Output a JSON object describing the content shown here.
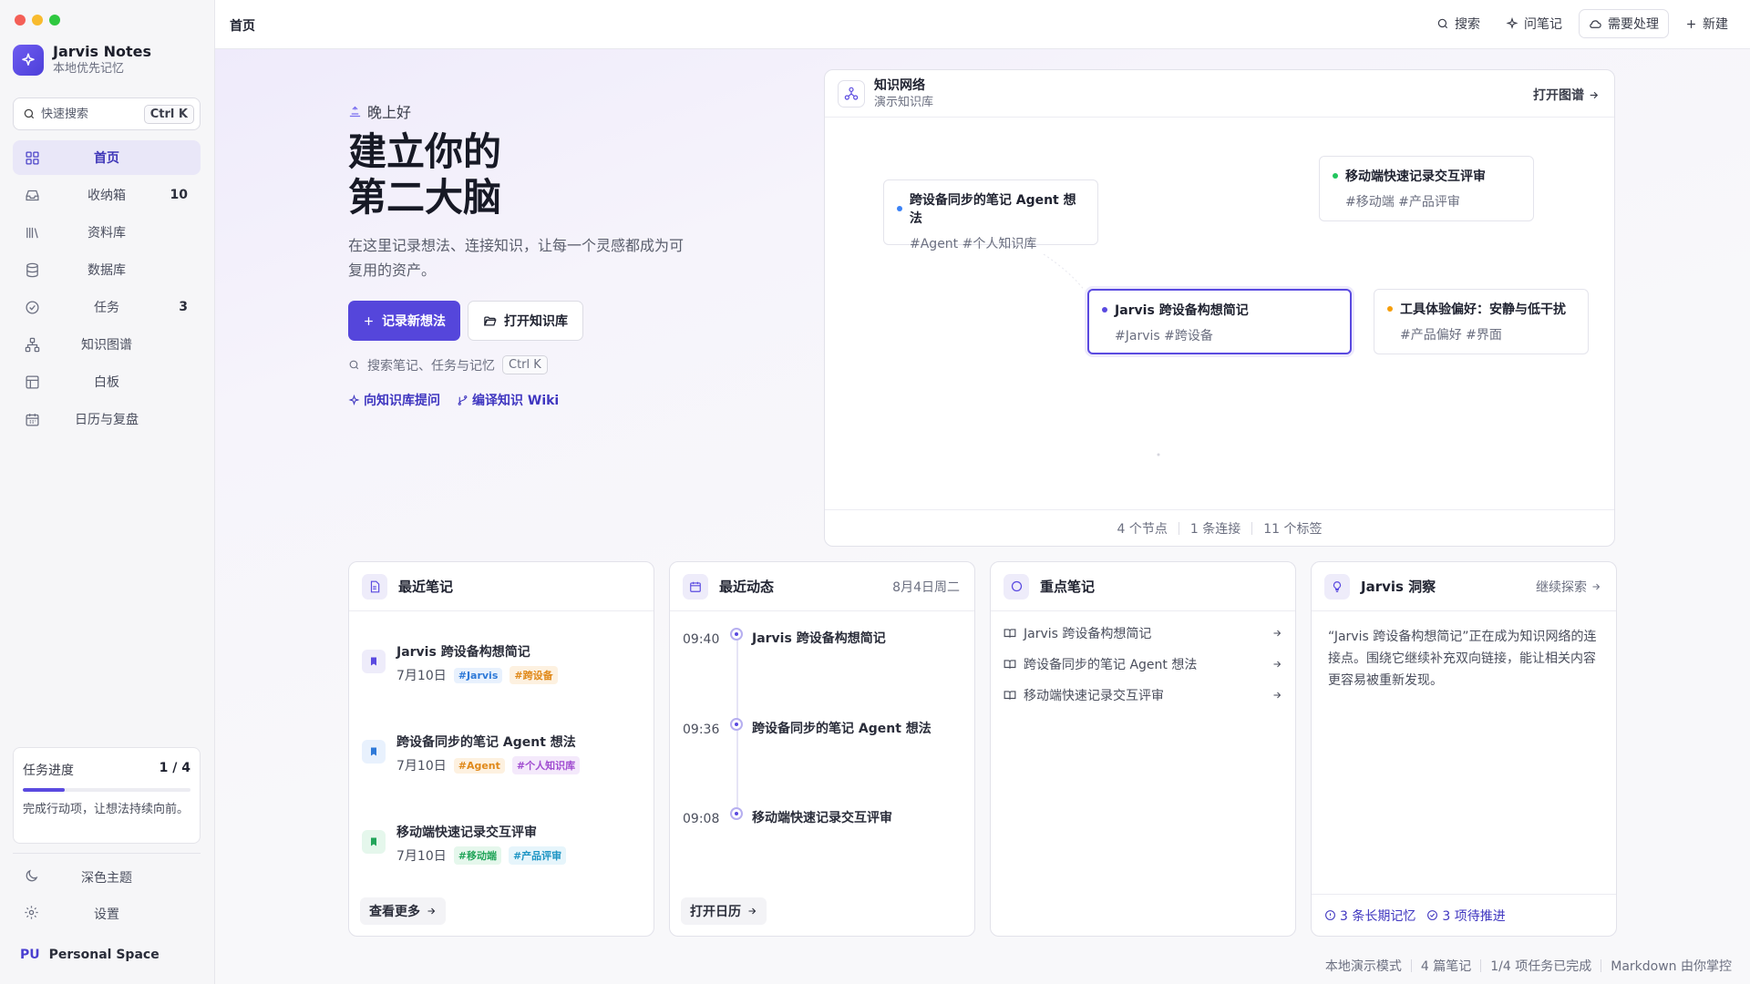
{
  "app": {
    "name": "Jarvis Notes",
    "subtitle": "本地优先记忆"
  },
  "sidebar": {
    "search_placeholder": "快速搜索",
    "search_shortcut": "Ctrl K",
    "items": [
      {
        "label": "首页",
        "icon": "grid-icon",
        "count": ""
      },
      {
        "label": "收纳箱",
        "icon": "inbox-icon",
        "count": "10"
      },
      {
        "label": "资料库",
        "icon": "library-icon",
        "count": ""
      },
      {
        "label": "数据库",
        "icon": "database-icon",
        "count": ""
      },
      {
        "label": "任务",
        "icon": "check-circle-icon",
        "count": "3"
      },
      {
        "label": "知识图谱",
        "icon": "graph-icon",
        "count": ""
      },
      {
        "label": "白板",
        "icon": "whiteboard-icon",
        "count": ""
      },
      {
        "label": "日历与复盘",
        "icon": "calendar-icon",
        "count": ""
      }
    ],
    "progress": {
      "label": "任务进度",
      "value": "1 / 4",
      "fraction": 0.25,
      "note": "完成行动项，让想法持续向前。"
    },
    "dark_theme": "深色主题",
    "settings": "设置",
    "space": {
      "badge": "PU",
      "name": "Personal Space"
    }
  },
  "topbar": {
    "breadcrumb": "首页",
    "search": "搜索",
    "ask": "问笔记",
    "needs_action": "需要处理",
    "new": "新建"
  },
  "hero": {
    "greeting": "晚上好",
    "title_line1": "建立你的",
    "title_line2": "第二大脑",
    "description": "在这里记录想法、连接知识，让每一个灵感都成为可复用的资产。",
    "primary_button": "记录新想法",
    "secondary_button": "打开知识库",
    "search_hint": "搜索笔记、任务与记忆",
    "search_shortcut": "Ctrl K",
    "link_ask": "向知识库提问",
    "link_wiki": "编译知识 Wiki"
  },
  "graph": {
    "title": "知识网络",
    "subtitle": "演示知识库",
    "open_label": "打开图谱",
    "nodes": [
      {
        "title": "跨设备同步的笔记 Agent 想法",
        "tags": "#Agent #个人知识库",
        "color": "#3b82f6"
      },
      {
        "title": "移动端快速记录交互评审",
        "tags": "#移动端 #产品评审",
        "color": "#22c55e"
      },
      {
        "title": "Jarvis 跨设备构想简记",
        "tags": "#Jarvis #跨设备",
        "color": "#5a4ae0"
      },
      {
        "title": "工具体验偏好：安静与低干扰",
        "tags": "#产品偏好 #界面",
        "color": "#f59e0b"
      }
    ],
    "stats": {
      "nodes": "4 个节点",
      "links": "1 条连接",
      "tags": "11 个标签"
    }
  },
  "recent_notes": {
    "title": "最近笔记",
    "items": [
      {
        "title": "Jarvis 跨设备构想简记",
        "date": "7月10日",
        "tags": [
          "#Jarvis",
          "#跨设备"
        ]
      },
      {
        "title": "跨设备同步的笔记 Agent 想法",
        "date": "7月10日",
        "tags": [
          "#Agent",
          "#个人知识库"
        ]
      },
      {
        "title": "移动端快速记录交互评审",
        "date": "7月10日",
        "tags": [
          "#移动端",
          "#产品评审"
        ]
      }
    ],
    "more": "查看更多"
  },
  "activity": {
    "title": "最近动态",
    "date": "8月4日周二",
    "items": [
      {
        "time": "09:40",
        "title": "Jarvis 跨设备构想简记"
      },
      {
        "time": "09:36",
        "title": "跨设备同步的笔记 Agent 想法"
      },
      {
        "time": "09:08",
        "title": "移动端快速记录交互评审"
      }
    ],
    "open_calendar": "打开日历"
  },
  "key_notes": {
    "title": "重点笔记",
    "items": [
      "Jarvis 跨设备构想简记",
      "跨设备同步的笔记 Agent 想法",
      "移动端快速记录交互评审"
    ]
  },
  "insight": {
    "title": "Jarvis 洞察",
    "explore": "继续探索",
    "text": "“Jarvis 跨设备构想简记”正在成为知识网络的连接点。围绕它继续补充双向链接，能让相关内容更容易被重新发现。",
    "memories": "3 条长期记忆",
    "pending": "3 项待推进"
  },
  "status": {
    "mode": "本地演示模式",
    "notes": "4 篇笔记",
    "tasks": "1/4 项任务已完成",
    "markdown": "Markdown 由你掌控"
  }
}
